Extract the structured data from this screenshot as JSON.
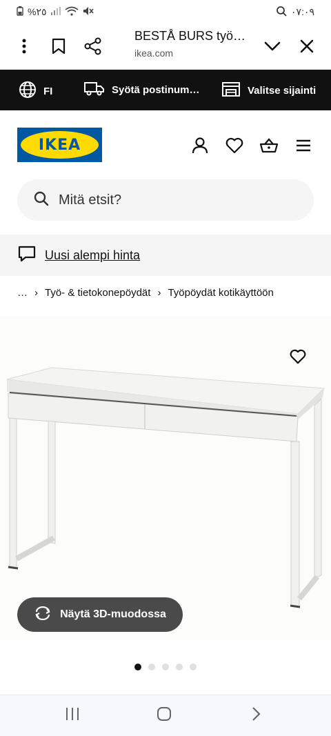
{
  "status": {
    "time": "٠٧:٠٩",
    "battery": "%٢٥"
  },
  "browser": {
    "title": "BESTÅ BURS työ…",
    "url": "ikea.com"
  },
  "topbar": {
    "language": "FI",
    "postcode": "Syötä postinum…",
    "location": "Valitse sijainti"
  },
  "logo": {
    "text": "IKEA"
  },
  "search": {
    "placeholder": "Mitä etsit?"
  },
  "banner": {
    "text": "Uusi alempi hinta"
  },
  "breadcrumb": {
    "items": [
      "…",
      "Työ- & tietokonepöydät",
      "Työpöydät kotikäyttöön"
    ]
  },
  "product": {
    "view3d_label": "Näytä 3D-muodossa",
    "image_count": 5,
    "active_image": 1
  },
  "colors": {
    "brand_blue": "#0058a3",
    "brand_yellow": "#ffdb00",
    "topbar_bg": "#111111"
  }
}
